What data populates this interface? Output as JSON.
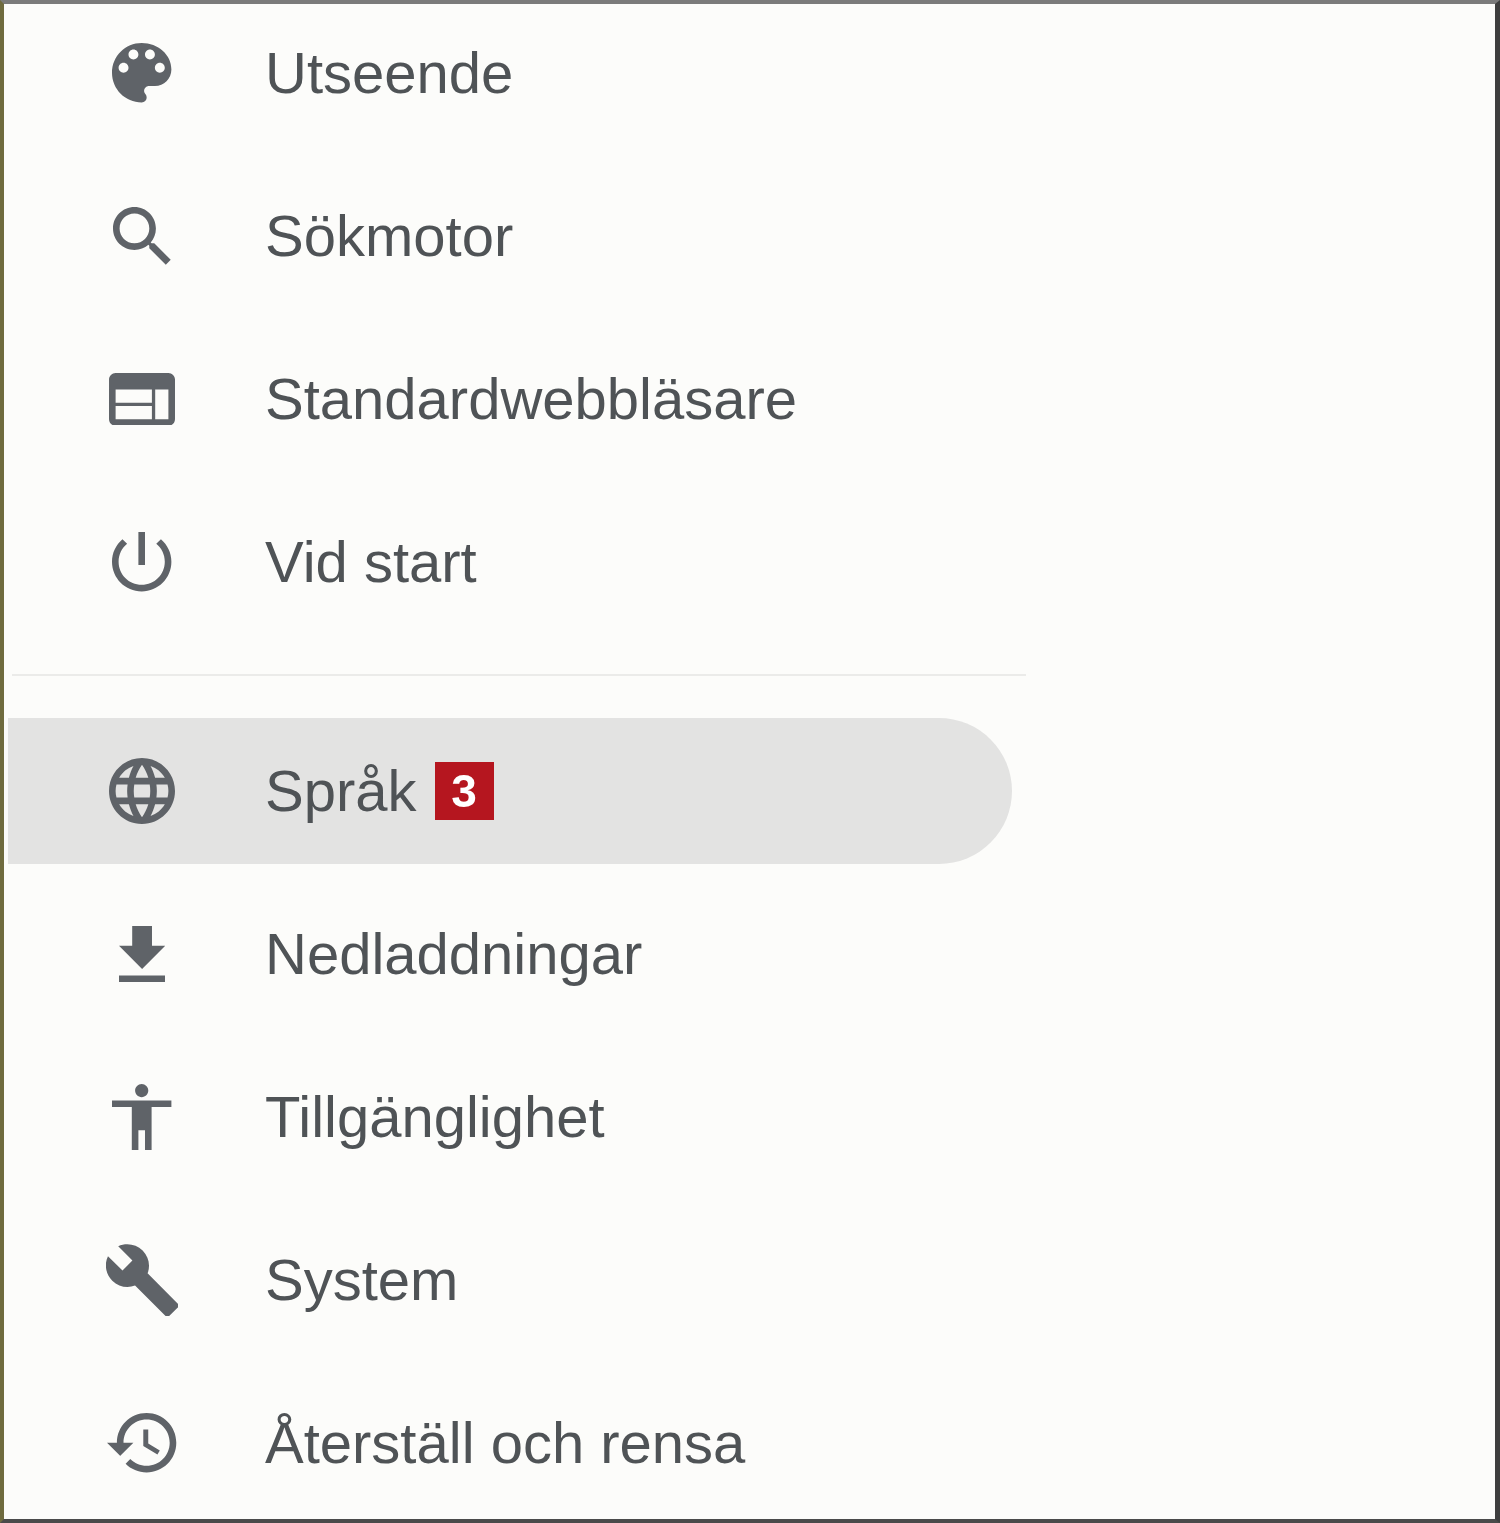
{
  "sections": [
    {
      "items": [
        {
          "label": "Utseende",
          "selected": false
        },
        {
          "label": "Sökmotor",
          "selected": false
        },
        {
          "label": "Standardwebbläsare",
          "selected": false
        },
        {
          "label": "Vid start",
          "selected": false
        }
      ]
    },
    {
      "items": [
        {
          "label": "Språk",
          "selected": true,
          "badge": "3"
        },
        {
          "label": "Nedladdningar",
          "selected": false
        },
        {
          "label": "Tillgänglighet",
          "selected": false
        },
        {
          "label": "System",
          "selected": false
        },
        {
          "label": "Återställ och rensa",
          "selected": false
        }
      ]
    }
  ]
}
